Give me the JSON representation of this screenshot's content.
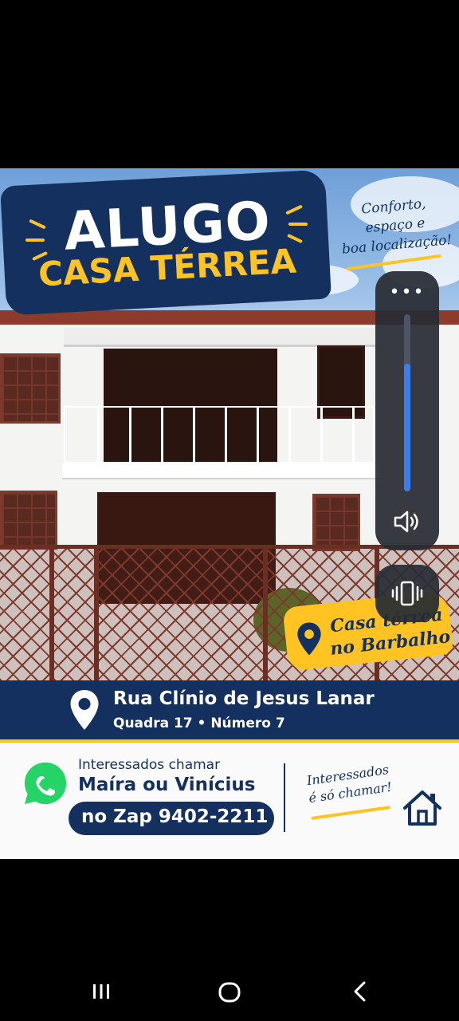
{
  "poster": {
    "headline_1": "ALUGO",
    "headline_2": "CASA TÉRREA",
    "tagline_l1": "Conforto,",
    "tagline_l2": "espaço e",
    "tagline_l3": "boa localização!",
    "location_tag_l1": "Casa térrea",
    "location_tag_l2": "no Barbalho",
    "address_street": "Rua Clínio de Jesus Lanar",
    "address_detail": "Quadra 17  •  Número 7",
    "contact_l1": "Interessados chamar",
    "contact_l2": "Maíra ou Vinícius",
    "contact_phone": "no Zap 9402-2211",
    "call_l1": "Interessados",
    "call_l2": "é só chamar!"
  },
  "volume_panel": {
    "more_label": "•••",
    "level_fraction": 0.72
  },
  "icons": {
    "volume": "speaker-icon",
    "vibrate": "vibrate-icon",
    "whatsapp": "whatsapp-icon",
    "location": "location-pin-icon",
    "home": "home-icon"
  },
  "colors": {
    "navy": "#13305f",
    "gold": "#ffc424",
    "whatsapp_green": "#25d366",
    "volume_fill": "#3d7df0"
  },
  "nav_bar": {
    "recents": "recents-icon",
    "home": "home-button-icon",
    "back": "back-icon"
  }
}
